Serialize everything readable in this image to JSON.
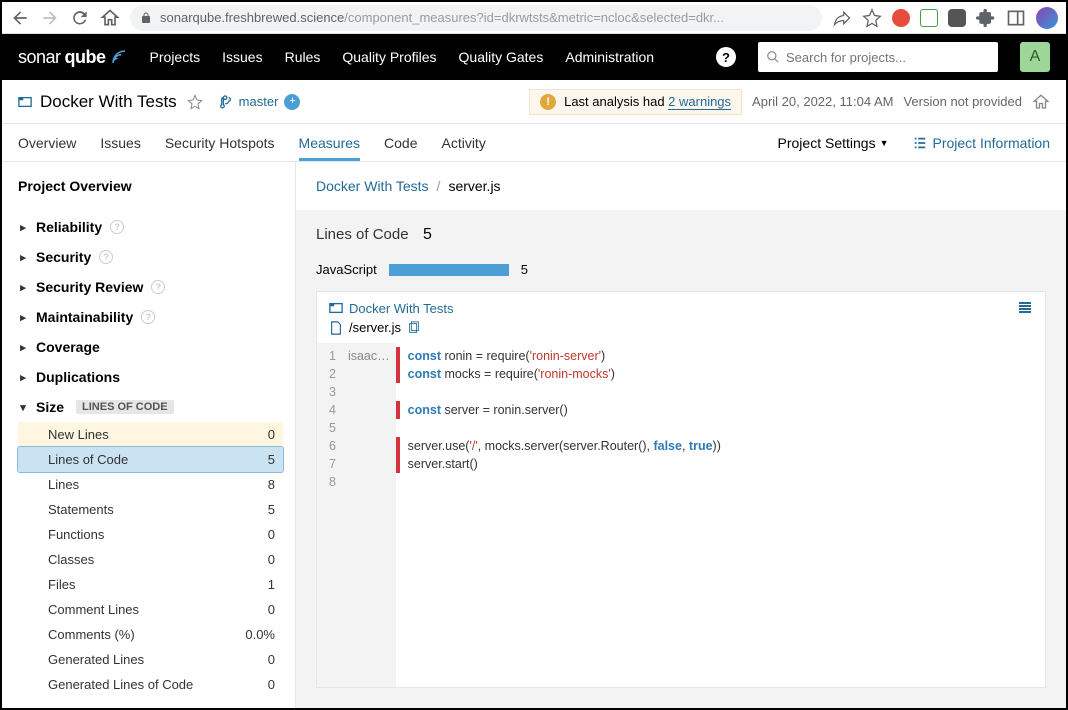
{
  "browser": {
    "url_host": "sonarqube.freshbrewed.science",
    "url_path": "/component_measures?id=dkrwtsts&metric=ncloc&selected=dkr..."
  },
  "topnav": {
    "items": [
      "Projects",
      "Issues",
      "Rules",
      "Quality Profiles",
      "Quality Gates",
      "Administration"
    ],
    "search_placeholder": "Search for projects...",
    "user_initial": "A"
  },
  "project": {
    "name": "Docker With Tests",
    "branch": "master",
    "warning_prefix": "Last analysis had ",
    "warning_link": "2 warnings",
    "analyzed_at": "April 20, 2022, 11:04 AM",
    "version": "Version not provided"
  },
  "tabs": {
    "items": [
      "Overview",
      "Issues",
      "Security Hotspots",
      "Measures",
      "Code",
      "Activity"
    ],
    "active": "Measures",
    "settings": "Project Settings",
    "info": "Project Information"
  },
  "sidebar": {
    "title": "Project Overview",
    "categories": [
      "Reliability",
      "Security",
      "Security Review",
      "Maintainability",
      "Coverage",
      "Duplications"
    ],
    "size_label": "Size",
    "size_badge": "LINES OF CODE",
    "leaves": [
      {
        "label": "New Lines",
        "value": "0",
        "state": "hl"
      },
      {
        "label": "Lines of Code",
        "value": "5",
        "state": "active"
      },
      {
        "label": "Lines",
        "value": "8",
        "state": ""
      },
      {
        "label": "Statements",
        "value": "5",
        "state": ""
      },
      {
        "label": "Functions",
        "value": "0",
        "state": ""
      },
      {
        "label": "Classes",
        "value": "0",
        "state": ""
      },
      {
        "label": "Files",
        "value": "1",
        "state": ""
      },
      {
        "label": "Comment Lines",
        "value": "0",
        "state": ""
      },
      {
        "label": "Comments (%)",
        "value": "0.0%",
        "state": ""
      },
      {
        "label": "Generated Lines",
        "value": "0",
        "state": ""
      },
      {
        "label": "Generated Lines of Code",
        "value": "0",
        "state": ""
      }
    ]
  },
  "content": {
    "crumb_project": "Docker With Tests",
    "crumb_file": "server.js",
    "metric_label": "Lines of Code",
    "metric_value": "5",
    "lang_name": "JavaScript",
    "lang_value": "5",
    "panel_crumb": "Docker With Tests",
    "panel_file": "/server.js",
    "blame_author": "isaac…",
    "code_lines": [
      {
        "n": 1,
        "mark": true,
        "html": "<span class='kw'>const</span> ronin = require(<span class='str'>'ronin-server'</span>)"
      },
      {
        "n": 2,
        "mark": true,
        "html": "<span class='kw'>const</span> mocks = require(<span class='str'>'ronin-mocks'</span>)"
      },
      {
        "n": 3,
        "mark": false,
        "html": ""
      },
      {
        "n": 4,
        "mark": true,
        "html": "<span class='kw'>const</span> server = ronin.server()"
      },
      {
        "n": 5,
        "mark": false,
        "html": ""
      },
      {
        "n": 6,
        "mark": true,
        "html": "server.use(<span class='str'>'/'</span>, mocks.server(server.Router(), <span class='kw'>false</span>, <span class='kw'>true</span>))"
      },
      {
        "n": 7,
        "mark": true,
        "html": "server.start()"
      },
      {
        "n": 8,
        "mark": false,
        "html": ""
      }
    ]
  }
}
